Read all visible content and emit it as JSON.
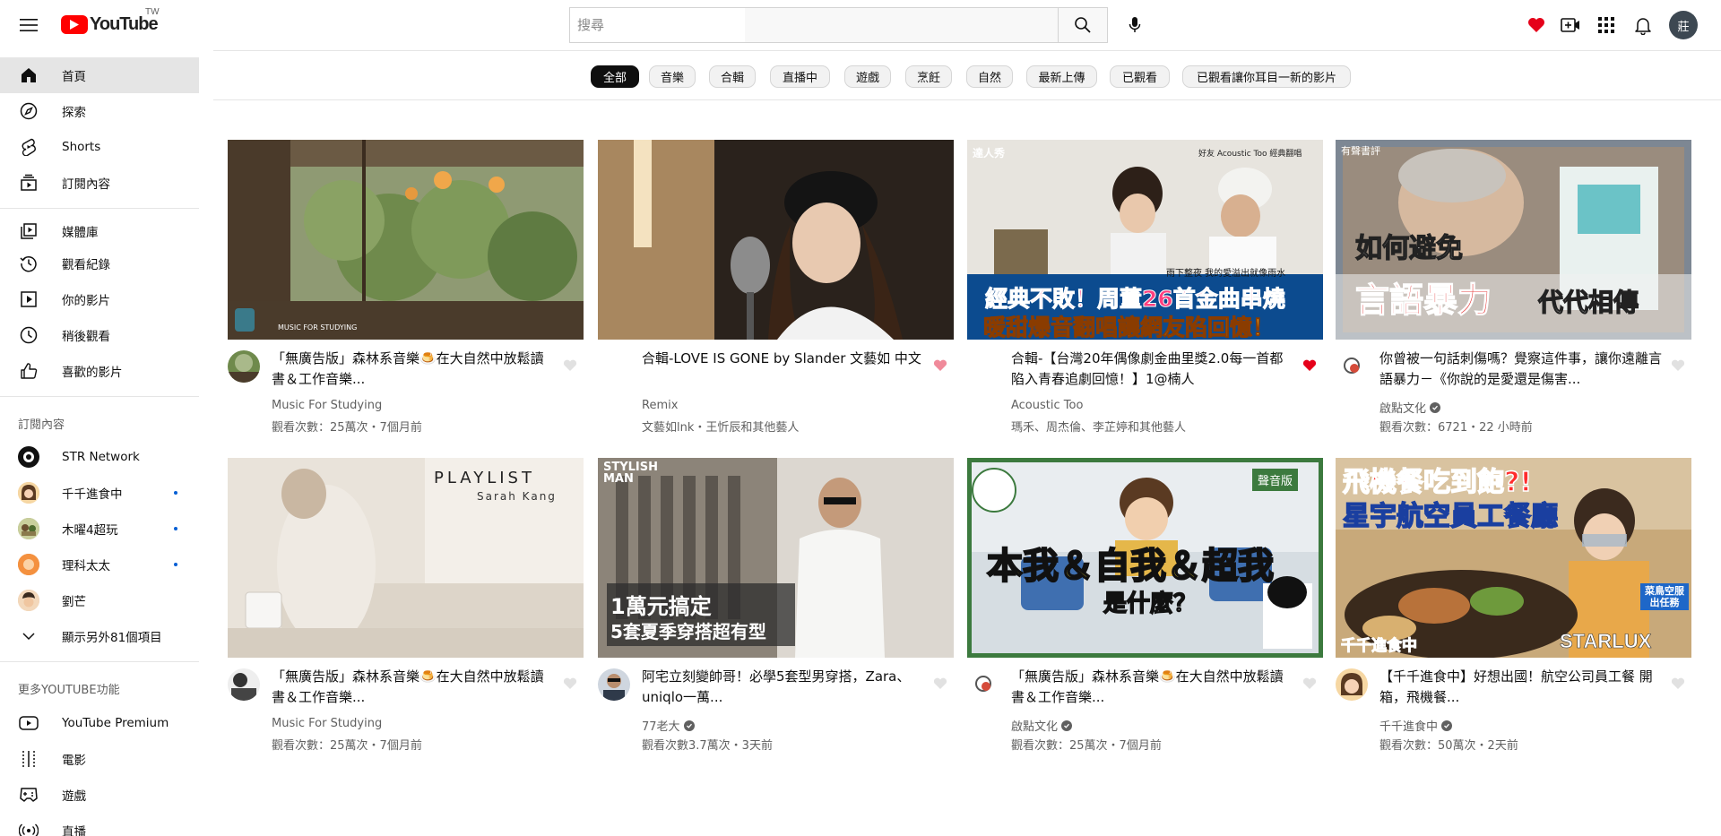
{
  "header": {
    "logo_text": "YouTube",
    "region": "TW",
    "search_placeholder": "搜尋",
    "user_avatar_initial": "莊"
  },
  "sidebar": {
    "main": [
      {
        "label": "首頁",
        "icon": "home-icon",
        "active": true
      },
      {
        "label": "探索",
        "icon": "explore-icon"
      },
      {
        "label": "Shorts",
        "icon": "shorts-icon"
      },
      {
        "label": "訂閱內容",
        "icon": "subscriptions-icon"
      }
    ],
    "library": [
      {
        "label": "媒體庫",
        "icon": "library-icon"
      },
      {
        "label": "觀看紀錄",
        "icon": "history-icon"
      },
      {
        "label": "你的影片",
        "icon": "your-videos-icon"
      },
      {
        "label": "稍後觀看",
        "icon": "watch-later-icon"
      },
      {
        "label": "喜歡的影片",
        "icon": "liked-videos-icon"
      }
    ],
    "subscriptions_heading": "訂閱內容",
    "subscriptions": [
      {
        "label": "STR Network",
        "color": "#111111",
        "new": false
      },
      {
        "label": "千千進食中",
        "color": "#e8a23a",
        "new": true
      },
      {
        "label": "木曜4超玩",
        "color": "#7a8c4a",
        "new": true
      },
      {
        "label": "理科太太",
        "color": "#f08a3c",
        "new": true
      },
      {
        "label": "劉芒",
        "color": "#e7b88a",
        "new": false
      }
    ],
    "show_more": "顯示另外81個項目",
    "more_heading": "更多YOUTUBE功能",
    "more": [
      {
        "label": "YouTube Premium",
        "icon": "youtube-premium-icon"
      },
      {
        "label": "電影",
        "icon": "movies-icon"
      },
      {
        "label": "遊戲",
        "icon": "gaming-icon"
      },
      {
        "label": "直播",
        "icon": "live-icon"
      }
    ]
  },
  "chips": [
    "全部",
    "音樂",
    "合輯",
    "直播中",
    "遊戲",
    "烹飪",
    "自然",
    "最新上傳",
    "已觀看",
    "已觀看讓你耳目一新的影片"
  ],
  "videos": [
    {
      "title": "「無廣告版」森林系音樂🍮在大自然中放鬆讀書＆工作音樂...",
      "channel": "Music For Studying",
      "verified": false,
      "meta": "觀看次數：25萬次・7個月前",
      "liked": false,
      "thumb_text": "MUSIC FOR STUDYING"
    },
    {
      "title": "合輯-LOVE IS GONE by Slander 文藝如 中文",
      "channel": "Remix",
      "verified": false,
      "meta": "文藝如lnk・王忻辰和其他藝人",
      "liked": "pink",
      "thumb_text": ""
    },
    {
      "title": "合輯-【台灣20年偶像劇金曲里獎2.0每一首都陷入青春追劇回憶！】1@楠人",
      "channel": "Acoustic Too",
      "verified": false,
      "meta": "瑪禾、周杰倫、李芷婷和其他藝人",
      "liked": "red",
      "thumb_text": "經典不敗！周董26首金曲串燒"
    },
    {
      "title": "你曾被一句話刺傷嗎？覺察這件事，讓你遠離言語暴力－《你說的是愛還是傷害...",
      "channel": "啟點文化",
      "verified": true,
      "meta": "觀看次數：6721・22 小時前",
      "liked": false,
      "thumb_text": "如何避免 言語暴力 代代相傳"
    },
    {
      "title": "「無廣告版」森林系音樂🍮在大自然中放鬆讀書＆工作音樂...",
      "channel": "Music For Studying",
      "verified": false,
      "meta": "觀看次數：25萬次・7個月前",
      "liked": false,
      "thumb_text": "PLAYLIST Sarah Kang"
    },
    {
      "title": "阿宅立刻變帥哥！必學5套型男穿搭，Zara、uniqlo一萬...",
      "channel": "77老大",
      "verified": true,
      "meta": "觀看次數3.7萬次・3天前",
      "liked": false,
      "thumb_text": "1萬元搞定 5套夏季穿搭超有型"
    },
    {
      "title": "「無廣告版」森林系音樂🍮在大自然中放鬆讀書＆工作音樂...",
      "channel": "啟點文化",
      "verified": true,
      "meta": "觀看次數：25萬次・7個月前",
      "liked": false,
      "thumb_text": "本我＆自我＆超我 是什麼？"
    },
    {
      "title": "【千千進食中】好想出國！航空公司員工餐 開箱，飛機餐...",
      "channel": "千千進食中",
      "verified": true,
      "meta": "觀看次數：50萬次・2天前",
      "liked": false,
      "thumb_text": "飛機餐吃到飽?! 星宇航空員工餐廳"
    }
  ],
  "thumb_labels": {
    "t3_badge": "達人秀",
    "t3_top": "好友 Acoustic Too 經典翻唱",
    "t3_line2": "暖甜爆音翻唱讓網友陷回憶！",
    "t3_small": "雨下整夜 我的愛溢出就像雨水",
    "t4_badge": "有聲書評",
    "t4_line1": "如何避免",
    "t4_line2": "言語暴力",
    "t4_line3": "代代相傳",
    "t5_line1": "PLAYLIST",
    "t5_line2": "Sarah Kang",
    "t6_brand": "STYLISH MAN",
    "t6_line1": "1萬元搞定",
    "t6_line2": "5套夏季穿搭超有型",
    "t7_badge": "聲音版",
    "t7_line1": "本我＆自我＆超我",
    "t7_line2": "是什麼？",
    "t8_line1": "飛機餐吃到飽?!",
    "t8_line2": "星宇航空員工餐廳",
    "t8_tag": "菜鳥空服 出任務",
    "t8_brand": "STARLUX",
    "t8_logo": "千千進食中",
    "t1_caption": "MUSIC FOR STUDYING",
    "t3_line1": "經典不敗！周董26首金曲串燒"
  }
}
